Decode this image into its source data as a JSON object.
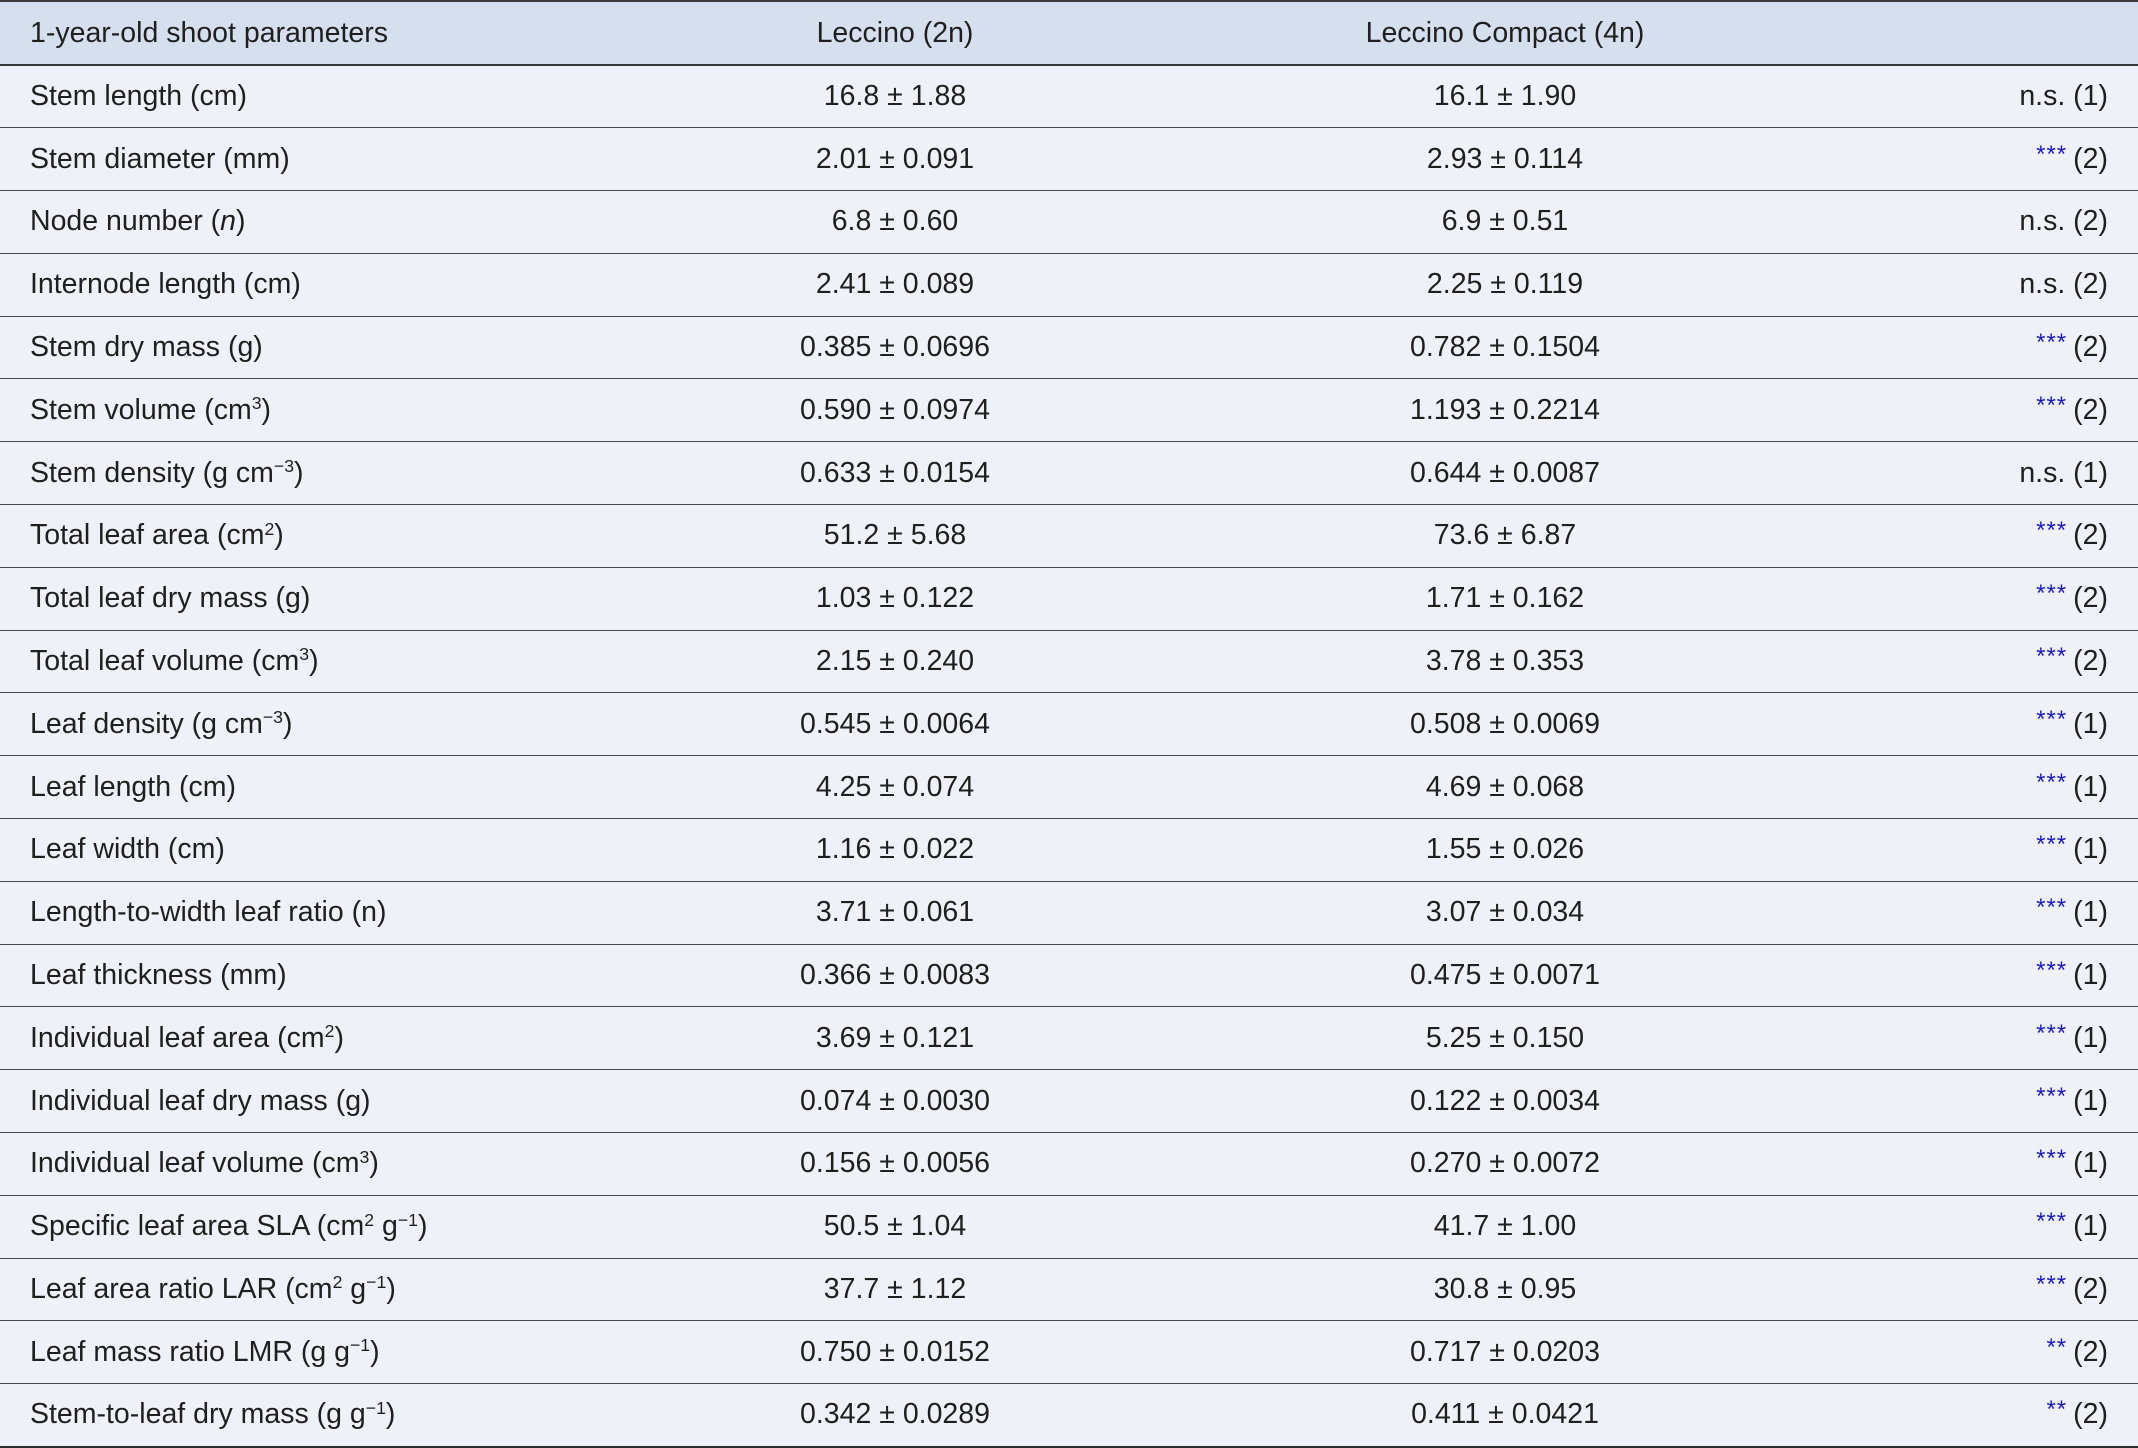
{
  "table": {
    "headers": [
      "1-year-old shoot parameters",
      "Leccino (2n)",
      "Leccino Compact (4n)",
      ""
    ],
    "rows": [
      {
        "pre": "Stem length (cm)",
        "sup": "",
        "post": "",
        "italic": "",
        "v2n": "16.8 ± 1.88",
        "v4n": "16.1 ± 1.90",
        "stars": "",
        "note": "n.s. (1)"
      },
      {
        "pre": "Stem diameter (mm)",
        "sup": "",
        "post": "",
        "italic": "",
        "v2n": "2.01 ± 0.091",
        "v4n": "2.93 ± 0.114",
        "stars": "***",
        "note": "(2)"
      },
      {
        "pre": "Node number (",
        "sup": "",
        "post": ")",
        "italic": "n",
        "v2n": "6.8 ± 0.60",
        "v4n": "6.9 ± 0.51",
        "stars": "",
        "note": "n.s. (2)"
      },
      {
        "pre": "Internode length (cm)",
        "sup": "",
        "post": "",
        "italic": "",
        "v2n": "2.41 ± 0.089",
        "v4n": "2.25 ± 0.119",
        "stars": "",
        "note": "n.s. (2)"
      },
      {
        "pre": "Stem dry mass (g)",
        "sup": "",
        "post": "",
        "italic": "",
        "v2n": "0.385 ± 0.0696",
        "v4n": "0.782 ± 0.1504",
        "stars": "***",
        "note": "(2)"
      },
      {
        "pre": "Stem volume (cm",
        "sup": "3",
        "post": ")",
        "italic": "",
        "v2n": "0.590 ± 0.0974",
        "v4n": "1.193 ± 0.2214",
        "stars": "***",
        "note": "(2)"
      },
      {
        "pre": "Stem density (g cm",
        "sup": "−3",
        "post": ")",
        "italic": "",
        "v2n": "0.633 ± 0.0154",
        "v4n": "0.644 ± 0.0087",
        "stars": "",
        "note": "n.s. (1)"
      },
      {
        "pre": "Total leaf area (cm",
        "sup": "2",
        "post": ")",
        "italic": "",
        "v2n": "51.2 ± 5.68",
        "v4n": "73.6 ± 6.87",
        "stars": "***",
        "note": "(2)"
      },
      {
        "pre": "Total leaf dry mass (g)",
        "sup": "",
        "post": "",
        "italic": "",
        "v2n": "1.03 ± 0.122",
        "v4n": "1.71 ± 0.162",
        "stars": "***",
        "note": "(2)"
      },
      {
        "pre": "Total leaf volume (cm",
        "sup": "3",
        "post": ")",
        "italic": "",
        "v2n": "2.15 ± 0.240",
        "v4n": "3.78 ± 0.353",
        "stars": "***",
        "note": "(2)"
      },
      {
        "pre": "Leaf density (g cm",
        "sup": "−3",
        "post": ")",
        "italic": "",
        "v2n": "0.545 ± 0.0064",
        "v4n": "0.508 ± 0.0069",
        "stars": "***",
        "note": "(1)"
      },
      {
        "pre": "Leaf length (cm)",
        "sup": "",
        "post": "",
        "italic": "",
        "v2n": "4.25 ± 0.074",
        "v4n": "4.69 ± 0.068",
        "stars": "***",
        "note": "(1)"
      },
      {
        "pre": "Leaf width (cm)",
        "sup": "",
        "post": "",
        "italic": "",
        "v2n": "1.16 ± 0.022",
        "v4n": "1.55 ± 0.026",
        "stars": "***",
        "note": "(1)"
      },
      {
        "pre": "Length-to-width leaf ratio (n)",
        "sup": "",
        "post": "",
        "italic": "",
        "v2n": "3.71 ± 0.061",
        "v4n": "3.07 ± 0.034",
        "stars": "***",
        "note": "(1)"
      },
      {
        "pre": "Leaf thickness (mm)",
        "sup": "",
        "post": "",
        "italic": "",
        "v2n": "0.366 ± 0.0083",
        "v4n": "0.475 ± 0.0071",
        "stars": "***",
        "note": "(1)"
      },
      {
        "pre": "Individual leaf area (cm",
        "sup": "2",
        "post": ")",
        "italic": "",
        "v2n": "3.69 ± 0.121",
        "v4n": "5.25 ± 0.150",
        "stars": "***",
        "note": "(1)"
      },
      {
        "pre": "Individual leaf dry mass (g)",
        "sup": "",
        "post": "",
        "italic": "",
        "v2n": "0.074 ± 0.0030",
        "v4n": "0.122 ± 0.0034",
        "stars": "***",
        "note": "(1)"
      },
      {
        "pre": "Individual leaf volume (cm",
        "sup": "3",
        "post": ")",
        "italic": "",
        "v2n": "0.156 ± 0.0056",
        "v4n": "0.270 ± 0.0072",
        "stars": "***",
        "note": "(1)"
      },
      {
        "pre": "Specific leaf area SLA (cm",
        "sup": "2",
        "post": " g",
        "sup2": "−1",
        "post2": ")",
        "italic": "",
        "v2n": "50.5 ± 1.04",
        "v4n": "41.7 ± 1.00",
        "stars": "***",
        "note": "(1)"
      },
      {
        "pre": "Leaf area ratio LAR (cm",
        "sup": "2",
        "post": " g",
        "sup2": "−1",
        "post2": ")",
        "italic": "",
        "v2n": "37.7 ± 1.12",
        "v4n": "30.8 ± 0.95",
        "stars": "***",
        "note": "(2)"
      },
      {
        "pre": "Leaf mass ratio LMR (g g",
        "sup": "−1",
        "post": ")",
        "italic": "",
        "v2n": "0.750 ± 0.0152",
        "v4n": "0.717 ± 0.0203",
        "stars": "**",
        "note": "(2)"
      },
      {
        "pre": "Stem-to-leaf dry mass (g g",
        "sup": "−1",
        "post": ")",
        "italic": "",
        "v2n": "0.342 ± 0.0289",
        "v4n": "0.411 ± 0.0421",
        "stars": "**",
        "note": "(2)"
      }
    ]
  },
  "colors": {
    "header_bg": "#d5dfee",
    "page_bg": "#eef1f7",
    "stars": "#1a1acc",
    "rule": "#3a3a3a"
  }
}
